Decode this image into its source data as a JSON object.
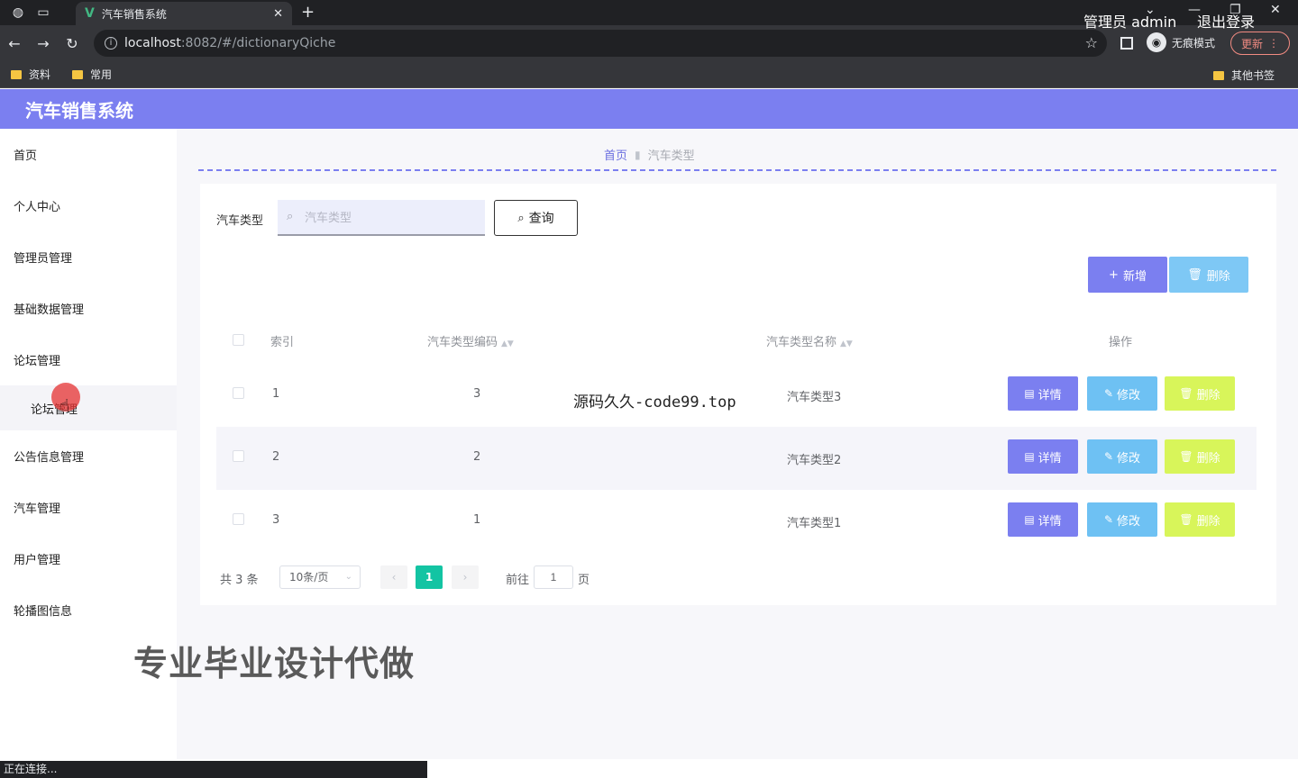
{
  "browser": {
    "tab_title": "汽车销售系统",
    "tab_logo": "V",
    "url_host": "localhost",
    "url_rest": ":8082/#/dictionaryQiche",
    "incognito_label": "无痕模式",
    "update_label": "更新",
    "bookmarks": [
      "资料",
      "常用"
    ],
    "bookmarks_other": "其他书签",
    "status_text": "正在连接..."
  },
  "header": {
    "title": "汽车销售系统",
    "user": "管理员 admin",
    "logout": "退出登录"
  },
  "sidebar": {
    "items": [
      {
        "label": "首页"
      },
      {
        "label": "个人中心"
      },
      {
        "label": "管理员管理"
      },
      {
        "label": "基础数据管理"
      },
      {
        "label": "论坛管理"
      }
    ],
    "sub_item": "论坛管理",
    "items_after": [
      {
        "label": "公告信息管理"
      },
      {
        "label": "汽车管理"
      },
      {
        "label": "用户管理"
      },
      {
        "label": "轮播图信息"
      }
    ]
  },
  "breadcrumb": {
    "home": "首页",
    "current": "汽车类型"
  },
  "search": {
    "label": "汽车类型",
    "placeholder": "汽车类型",
    "query_label": "查询"
  },
  "actions": {
    "add_label": "新增",
    "delete_label": "删除"
  },
  "table": {
    "headers": {
      "index": "索引",
      "code": "汽车类型编码",
      "name": "汽车类型名称",
      "ops": "操作"
    },
    "rows": [
      {
        "index": "1",
        "code": "3",
        "name": "汽车类型3"
      },
      {
        "index": "2",
        "code": "2",
        "name": "汽车类型2"
      },
      {
        "index": "3",
        "code": "1",
        "name": "汽车类型1"
      }
    ],
    "op_labels": {
      "detail": "详情",
      "edit": "修改",
      "delete": "删除"
    }
  },
  "pagination": {
    "total": "共 3 条",
    "page_size": "10条/页",
    "current": "1",
    "goto_label": "前往",
    "goto_value": "1",
    "unit": "页"
  },
  "overlays": {
    "source": "源码久久-code99.top",
    "ad": "专业毕业设计代做"
  }
}
